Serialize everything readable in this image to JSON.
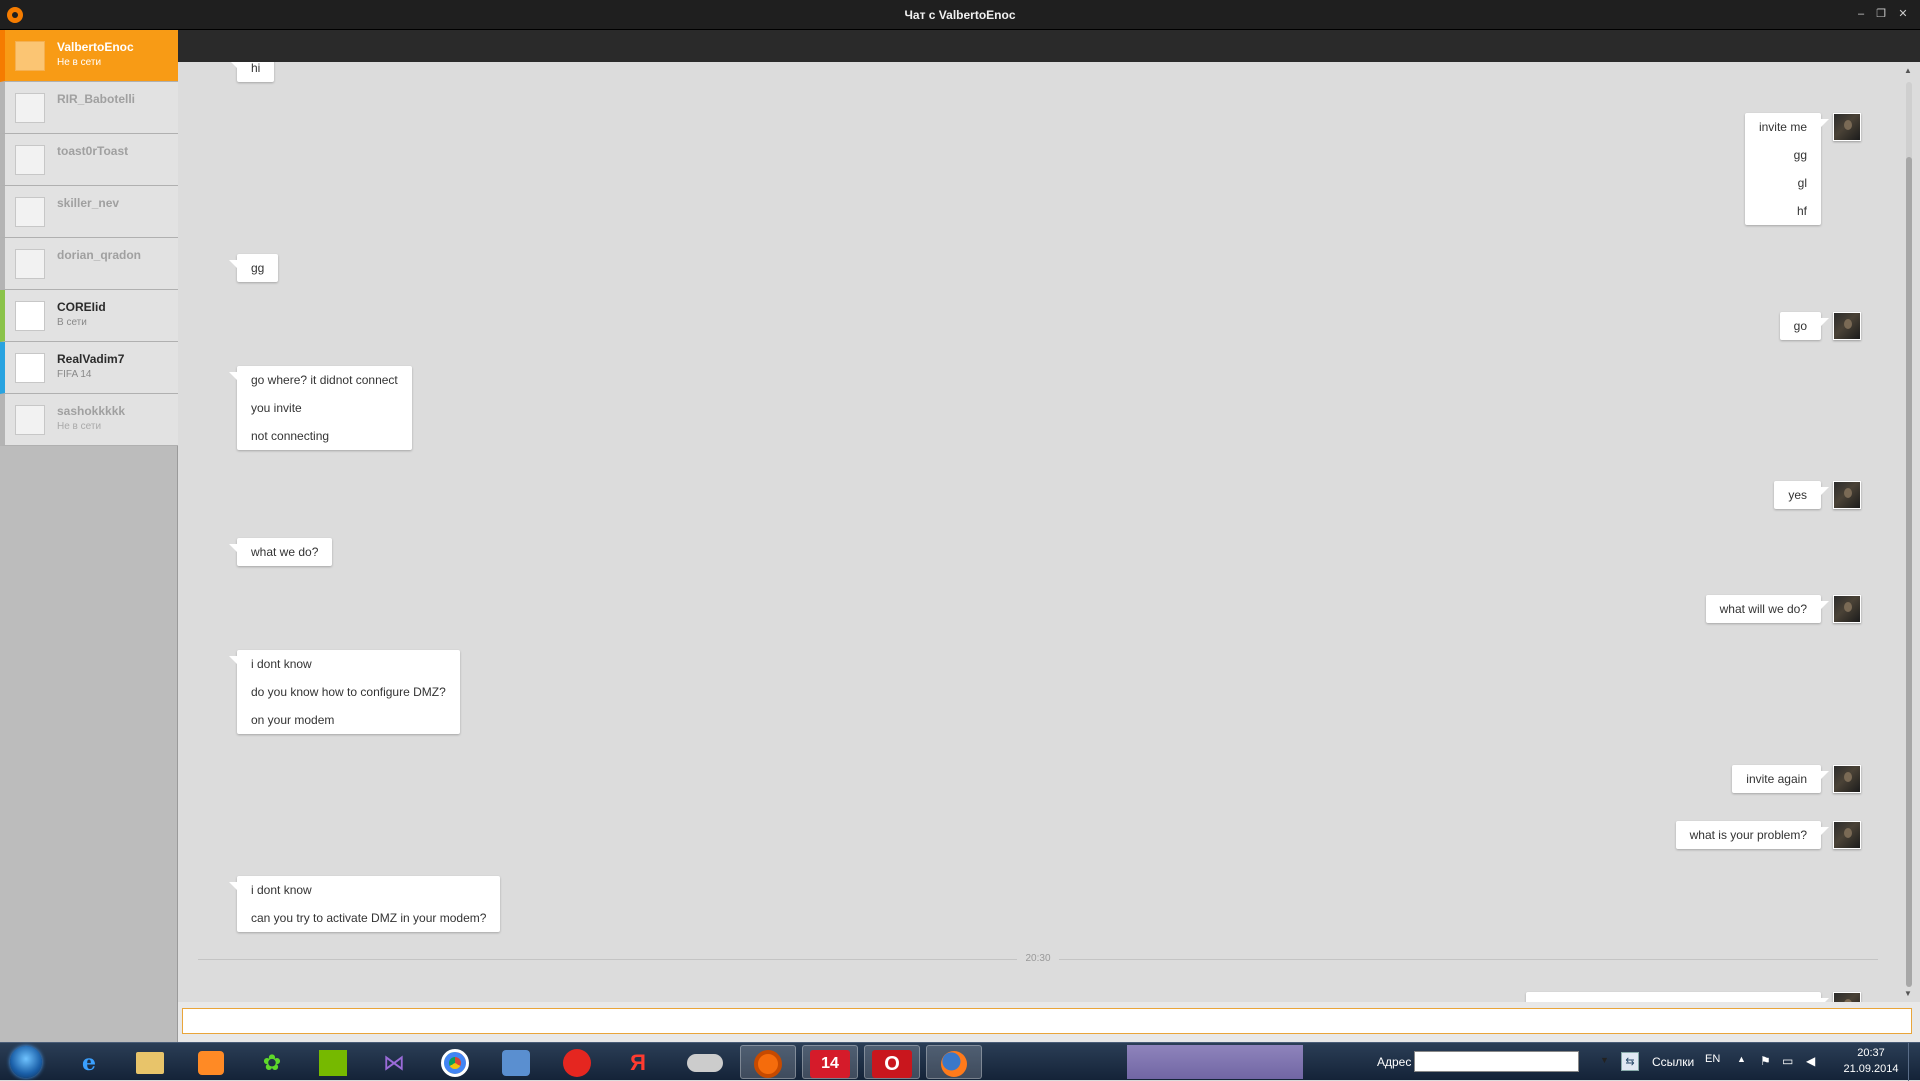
{
  "window": {
    "title": "Чат с ValbertoEnoc",
    "minimize": "–",
    "restore": "❐",
    "close": "✕"
  },
  "friends": [
    {
      "name": "ValbertoEnoc",
      "status": "Не в сети",
      "state": "selected"
    },
    {
      "name": "RIR_Babotelli",
      "status": "",
      "state": "offline"
    },
    {
      "name": "toast0rToast",
      "status": "",
      "state": "offline"
    },
    {
      "name": "skiller_nev",
      "status": "",
      "state": "offline"
    },
    {
      "name": "dorian_qradon",
      "status": "",
      "state": "offline"
    },
    {
      "name": "COREIid",
      "status": "В сети",
      "state": "online",
      "accent": "#8bc34a"
    },
    {
      "name": "RealVadim7",
      "status": "FIFA 14",
      "state": "online",
      "accent": "#29a3e0"
    },
    {
      "name": "sashokkkkk",
      "status": "Не в сети",
      "state": "offline"
    }
  ],
  "messages": [
    {
      "side": "left",
      "lines": [
        "hi"
      ]
    },
    {
      "side": "right",
      "lines": [
        "invite me",
        "gg",
        "gl",
        "hf"
      ]
    },
    {
      "side": "left",
      "lines": [
        "gg"
      ]
    },
    {
      "side": "right",
      "lines": [
        "go"
      ]
    },
    {
      "side": "left",
      "lines": [
        "go where? it didnot connect",
        "you invite",
        "not connecting"
      ]
    },
    {
      "side": "right",
      "lines": [
        "yes"
      ]
    },
    {
      "side": "left",
      "lines": [
        "what we do?"
      ]
    },
    {
      "side": "right",
      "lines": [
        "what will we do?"
      ]
    },
    {
      "side": "left",
      "lines": [
        "i dont know",
        "do you know how to configure DMZ?",
        "on your modem"
      ]
    },
    {
      "side": "right",
      "lines": [
        "invite again"
      ]
    },
    {
      "side": "right",
      "lines": [
        "what is your problem?"
      ]
    },
    {
      "side": "left",
      "lines": [
        "i dont know",
        "can you try to activate DMZ in your modem?"
      ]
    }
  ],
  "time_divider": "20:30",
  "input": {
    "value": "",
    "placeholder": ""
  },
  "taskbar": {
    "address_label": "Адрес",
    "links_label": "Ссылки",
    "language": "EN",
    "clock_time": "20:37",
    "clock_date": "21.09.2014",
    "icons": [
      "internet-explorer-icon",
      "explorer-icon",
      "media-player-icon",
      "icq-icon",
      "nvidia-icon",
      "visual-studio-icon",
      "chrome-icon",
      "volume-icon",
      "yandex-browser-icon",
      "yandex-icon",
      "gamepad-icon",
      "origin-icon",
      "fifa-14-icon",
      "opera-icon",
      "firefox-icon"
    ]
  },
  "colors": {
    "accent": "#f57c00",
    "selected_bg": "#f89b15",
    "chat_bg": "#dcdcdc"
  }
}
